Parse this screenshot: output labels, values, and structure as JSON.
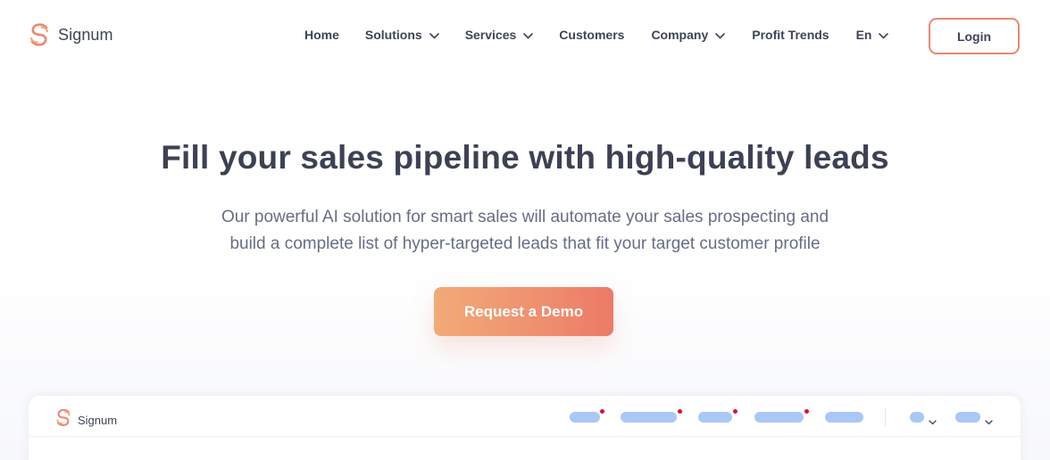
{
  "brand": {
    "name": "Signum",
    "accent": "#ec8770"
  },
  "nav": {
    "items": [
      {
        "label": "Home",
        "dropdown": false
      },
      {
        "label": "Solutions",
        "dropdown": true
      },
      {
        "label": "Services",
        "dropdown": true
      },
      {
        "label": "Customers",
        "dropdown": false
      },
      {
        "label": "Company",
        "dropdown": true
      },
      {
        "label": "Profit Trends",
        "dropdown": false
      }
    ],
    "language": "En",
    "login_label": "Login"
  },
  "hero": {
    "title": "Fill your sales pipeline with high-quality leads",
    "subtitle_line1": "Our powerful AI solution for smart sales will automate your sales prospecting and",
    "subtitle_line2": "build a complete list of hyper-targeted leads that fit your target customer profile",
    "cta_label": "Request a Demo",
    "cta_gradient": [
      "#f2aa77",
      "#ec7a67"
    ]
  },
  "preview": {
    "brand_name": "Signum",
    "placeholder_color": "#a9c8f5",
    "notification_color": "#d9142b"
  },
  "icons": {
    "logo": "signum-logo-icon",
    "dropdown": "chevron-down-icon"
  }
}
